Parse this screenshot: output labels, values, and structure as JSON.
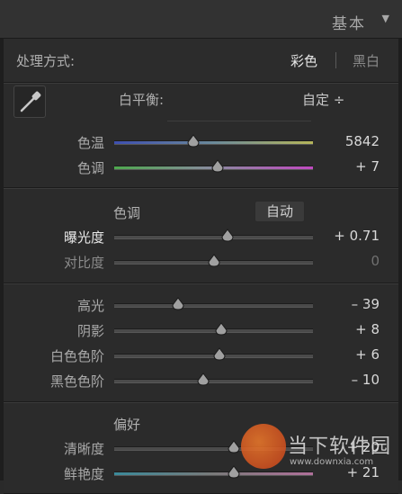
{
  "header": {
    "title": "基本",
    "collapse_icon": "triangle-down-icon"
  },
  "treatment": {
    "label": "处理方式:",
    "color_option": "彩色",
    "bw_option": "黑白"
  },
  "white_balance": {
    "picker_icon": "eyedropper-icon",
    "label": "白平衡:",
    "value": "自定 ÷"
  },
  "wb_sliders": [
    {
      "label": "色温",
      "value": "5842",
      "level": 0.4,
      "track": "temp"
    },
    {
      "label": "色调",
      "value": "+ 7",
      "level": 0.52,
      "track": "tint"
    }
  ],
  "tone": {
    "heading": "色调",
    "auto_label": "自动",
    "sliders": [
      {
        "label": "曝光度",
        "value": "+ 0.71",
        "level": 0.57
      },
      {
        "label": "对比度",
        "value": "0",
        "level": 0.5
      }
    ]
  },
  "tone2": {
    "sliders": [
      {
        "label": "高光",
        "value": "– 39",
        "level": 0.32
      },
      {
        "label": "阴影",
        "value": "+ 8",
        "level": 0.54
      },
      {
        "label": "白色色阶",
        "value": "+ 6",
        "level": 0.53
      },
      {
        "label": "黑色色阶",
        "value": "– 10",
        "level": 0.45
      }
    ]
  },
  "presence": {
    "heading": "偏好",
    "sliders": [
      {
        "label": "清晰度",
        "value": "+ 20",
        "level": 0.6
      },
      {
        "label": "鲜艳度",
        "value": "+ 21",
        "level": 0.6
      }
    ]
  },
  "watermark": {
    "brand": "当下软件园",
    "url": "www.downxia.com"
  }
}
